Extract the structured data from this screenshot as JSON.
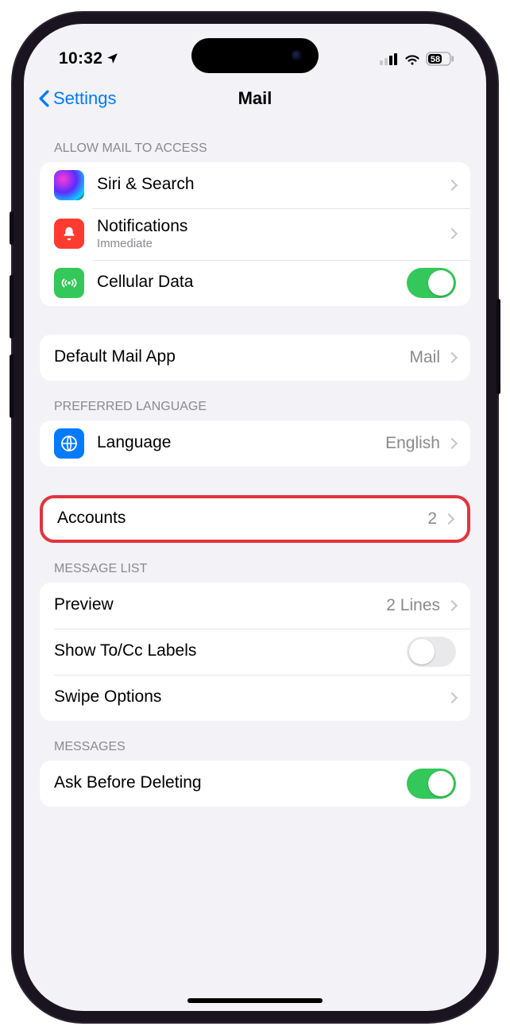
{
  "status": {
    "time": "10:32",
    "battery": "58"
  },
  "nav": {
    "back": "Settings",
    "title": "Mail"
  },
  "sections": {
    "access": {
      "header": "ALLOW MAIL TO ACCESS",
      "siri": "Siri & Search",
      "notifications": "Notifications",
      "notifications_sub": "Immediate",
      "cellular": "Cellular Data"
    },
    "default_app": {
      "label": "Default Mail App",
      "value": "Mail"
    },
    "language": {
      "header": "PREFERRED LANGUAGE",
      "label": "Language",
      "value": "English"
    },
    "accounts": {
      "label": "Accounts",
      "value": "2"
    },
    "message_list": {
      "header": "MESSAGE LIST",
      "preview": "Preview",
      "preview_value": "2 Lines",
      "showtocc": "Show To/Cc Labels",
      "swipe": "Swipe Options"
    },
    "messages": {
      "header": "MESSAGES",
      "ask": "Ask Before Deleting"
    }
  }
}
